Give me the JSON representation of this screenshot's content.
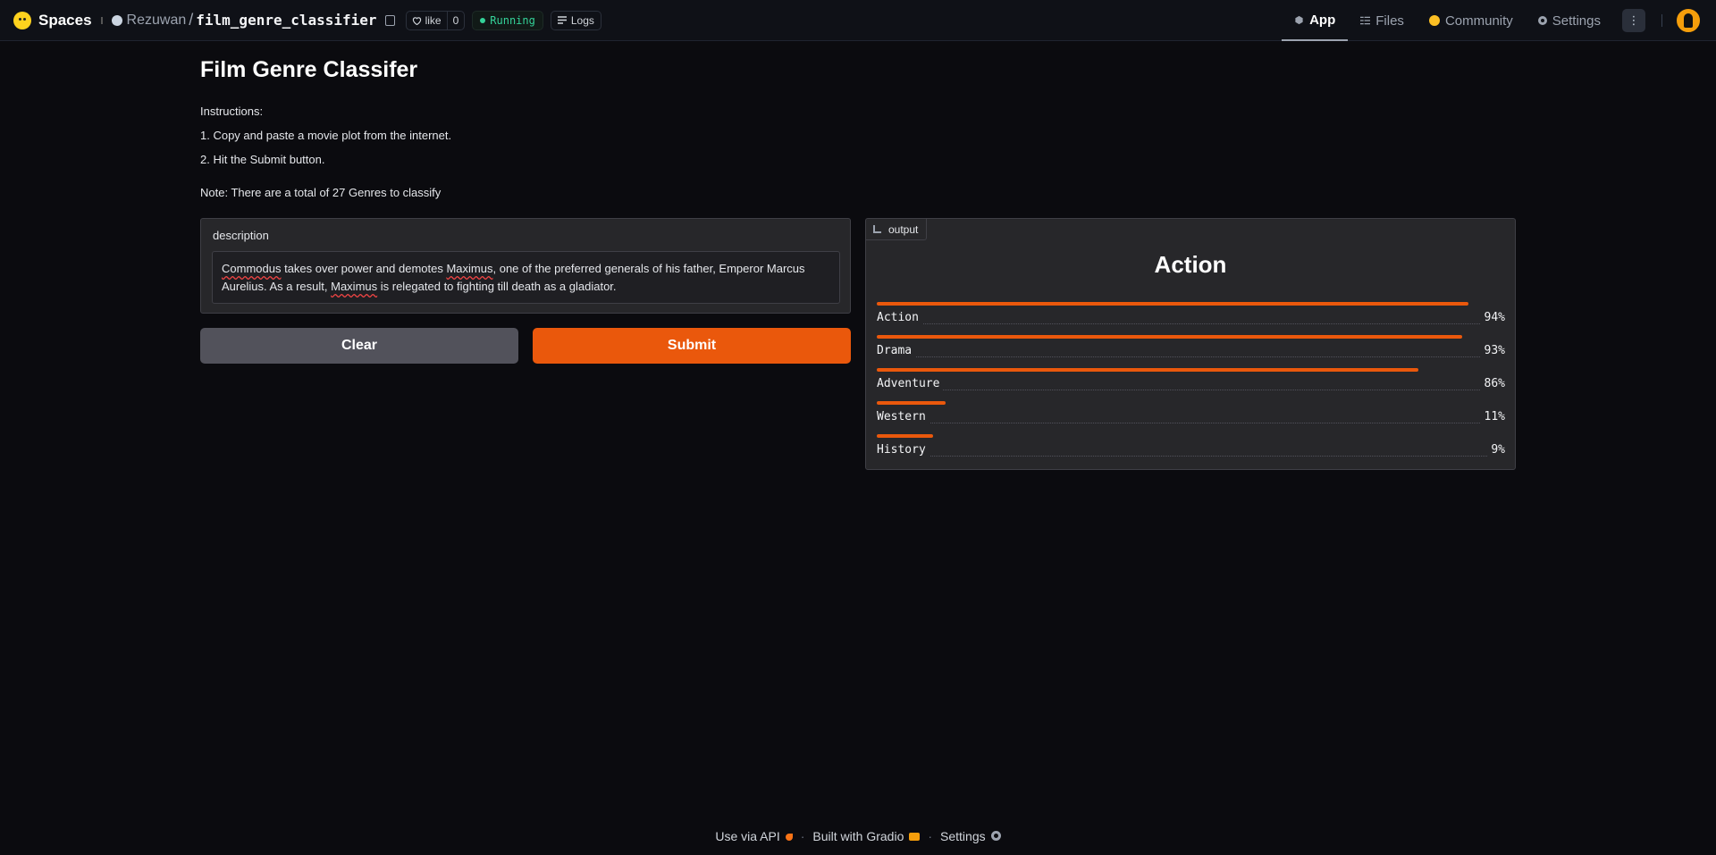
{
  "topbar": {
    "brand": "Spaces",
    "owner": "Rezuwan",
    "repo": "film_genre_classifier",
    "like_label": "like",
    "like_count": "0",
    "status": "Running",
    "logs": "Logs",
    "nav": {
      "app": "App",
      "files": "Files",
      "community": "Community",
      "settings": "Settings"
    }
  },
  "main": {
    "title": "Film Genre Classifer",
    "instructions": [
      "Instructions:",
      "1. Copy and paste a movie plot from the internet.",
      "2. Hit the Submit button."
    ],
    "note": "Note: There are a total of 27 Genres to classify"
  },
  "input": {
    "label": "description",
    "value_parts": [
      "Commodus",
      " takes over power and demotes ",
      "Maximus",
      ", one of the preferred generals of his father, Emperor Marcus Aurelius. As a result, ",
      "Maximus",
      " is relegated to fighting till death as a gladiator."
    ]
  },
  "buttons": {
    "clear": "Clear",
    "submit": "Submit"
  },
  "output": {
    "tag": "output",
    "top_label": "Action",
    "confidences": [
      {
        "label": "Action",
        "value": 0.94,
        "pct": "94%"
      },
      {
        "label": "Drama",
        "value": 0.93,
        "pct": "93%"
      },
      {
        "label": "Adventure",
        "value": 0.86,
        "pct": "86%"
      },
      {
        "label": "Western",
        "value": 0.11,
        "pct": "11%"
      },
      {
        "label": "History",
        "value": 0.09,
        "pct": "9%"
      }
    ]
  },
  "footer": {
    "api": "Use via API",
    "built": "Built with Gradio",
    "settings": "Settings"
  },
  "colors": {
    "accent": "#ea580c",
    "running": "#34d399",
    "background": "#0b0b0f"
  }
}
